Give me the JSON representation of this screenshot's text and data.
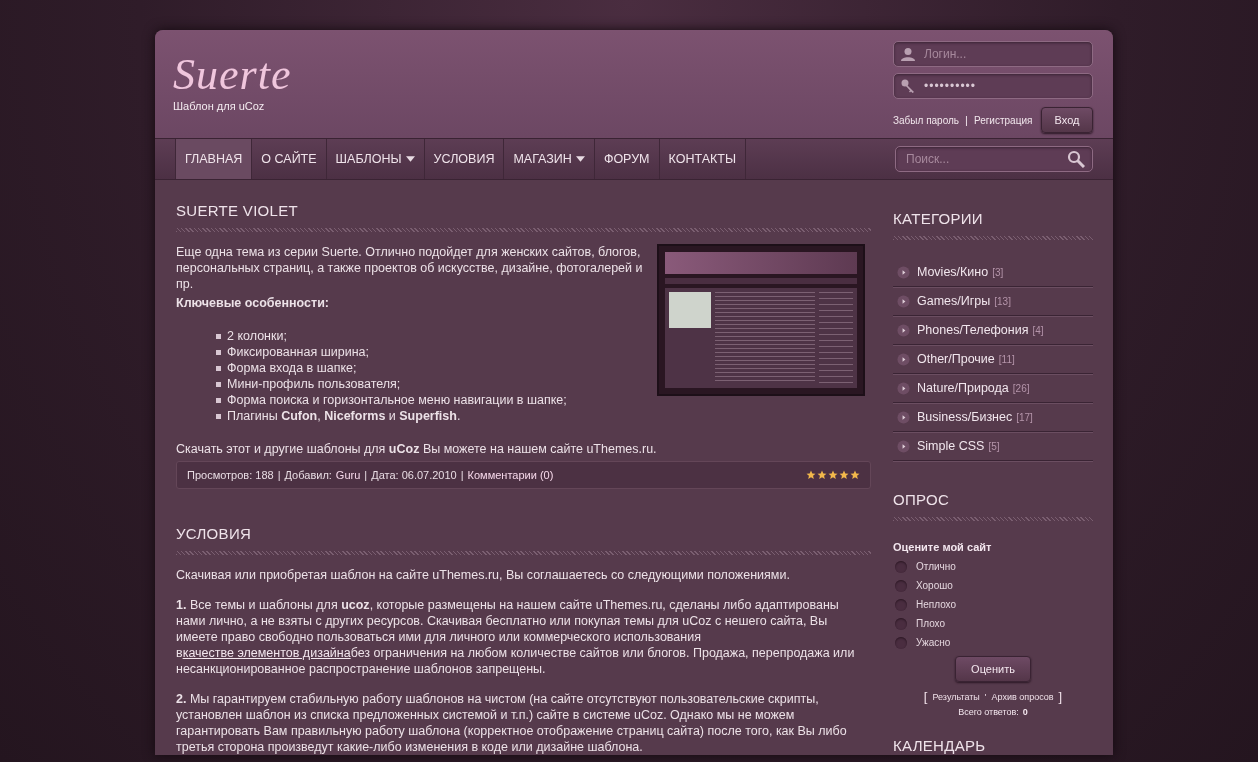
{
  "header": {
    "logo": "Suerte",
    "tagline": "Шаблон для uCoz",
    "login": {
      "username_placeholder": "Логин...",
      "password_value": "••••••••••",
      "forgot_link": "Забыл пароль",
      "separator": "|",
      "register_link": "Регистрация",
      "submit": "Вход"
    }
  },
  "nav": {
    "items": [
      {
        "label": "ГЛАВНАЯ",
        "selected": true,
        "dropdown": false
      },
      {
        "label": "О САЙТЕ",
        "selected": false,
        "dropdown": false
      },
      {
        "label": "ШАБЛОНЫ",
        "selected": false,
        "dropdown": true
      },
      {
        "label": "УСЛОВИЯ",
        "selected": false,
        "dropdown": false
      },
      {
        "label": "МАГАЗИН",
        "selected": false,
        "dropdown": true
      },
      {
        "label": "ФОРУМ",
        "selected": false,
        "dropdown": false
      },
      {
        "label": "КОНТАКТЫ",
        "selected": false,
        "dropdown": false
      }
    ],
    "search_placeholder": "Поиск..."
  },
  "article": {
    "title": "SUERTE VIOLET",
    "intro": "Еще одна тема из серии Suerte. Отлично подойдет для женских сайтов, блогов, персональных страниц, а также проектов об искусстве, дизайне, фотогалерей и пр.",
    "features_title": "Ключевые особенности:",
    "features": [
      "2 колонки;",
      "Фиксированная ширина;",
      "Форма входа в шапке;",
      "Мини-профиль пользователя;",
      "Форма поиска и горизонтальное меню навигации в шапке;",
      "Плагины **Cufon**, **Niceforms** и **Superfish**."
    ],
    "download": "Скачать этот и другие шаблоны для **uCoz** Вы можете на нашем сайте uThemes.ru.",
    "meta": {
      "views": "Просмотров: 188",
      "separator": "|",
      "author_label": "Добавил:",
      "author": "Guru",
      "date": "Дата: 06.07.2010",
      "comments": "Комментарии (0)",
      "stars": 5
    }
  },
  "terms": {
    "title": "УСЛОВИЯ",
    "intro": "Скачивая или приобретая шаблон на сайте uThemes.ru, Вы соглашаетесь со следующими положениями.",
    "paragraphs": [
      {
        "number": "1.",
        "before": "Все темы и шаблоны для **ucoz**, которые размещены на нашем сайте uThemes.ru, сделаны либо адаптированы нами лично, а не взяты с других ресурсов. Скачивая бесплатно или покупая темы для uCoz с нешего сайта, Вы имеете право свободно пользоваться ими для личного или коммерческого использования в",
        "link": "качестве элементов дизайна",
        "after": "без ограничения на любом количестве сайтов или блогов. Продажа, перепродажа или несанкционированное распространение шаблонов запрещены."
      },
      {
        "number": "2.",
        "before": "Мы гарантируем стабильную работу шаблонов на чистом (на сайте отсутствуют пользовательские скрипты, установлен шаблон из списка предложенных системой и т.п.) сайте в системе uCoz. Однако мы не можем гарантировать Вам правильную работу шаблона (корректное отображение страниц сайта) после того, как Вы либо третья сторона произведут какие-либо изменения в коде или дизайне шаблона."
      }
    ]
  },
  "sidebar": {
    "categories": {
      "title": "КАТЕГОРИИ",
      "items": [
        {
          "name": "Movies/Кино",
          "count": "[3]"
        },
        {
          "name": "Games/Игры",
          "count": "[13]"
        },
        {
          "name": "Phones/Телефония",
          "count": "[4]"
        },
        {
          "name": "Other/Прочие",
          "count": "[11]"
        },
        {
          "name": "Nature/Природа",
          "count": "[26]"
        },
        {
          "name": "Business/Бизнес",
          "count": "[17]"
        },
        {
          "name": "Simple CSS",
          "count": "[5]"
        }
      ]
    },
    "poll": {
      "title": "ОПРОС",
      "question": "Оцените мой сайт",
      "options": [
        {
          "label": "Отлично",
          "selected": false
        },
        {
          "label": "Хорошо",
          "selected": false
        },
        {
          "label": "Неплохо",
          "selected": false
        },
        {
          "label": "Плохо",
          "selected": false
        },
        {
          "label": "Ужасно",
          "selected": false
        }
      ],
      "submit": "Оценить",
      "open_bracket": "[",
      "results_link": "Результаты",
      "separator": "'",
      "archive_link": "Архив опросов",
      "close_bracket": "]",
      "total_label": "Всего ответов:",
      "total": "0"
    },
    "calendar": {
      "title": "КАЛЕНДАРЬ"
    }
  }
}
